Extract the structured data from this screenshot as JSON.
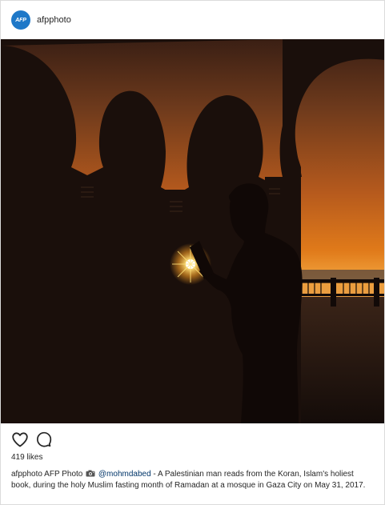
{
  "header": {
    "avatar_text": "AFP",
    "username": "afpphoto"
  },
  "photo": {
    "description_icon": "sunset-mosque-photo"
  },
  "actions": {
    "like_icon": "heart-icon",
    "comment_icon": "comment-icon"
  },
  "likes": {
    "text": "419 likes"
  },
  "caption": {
    "username": "afpphoto",
    "text_before_camera": " AFP Photo ",
    "camera_icon": "camera-icon",
    "mention": " @mohmdabed",
    "text_after": " - A Palestinian man reads from the Koran, Islam's holiest book, during the holy Muslim fasting month of Ramadan at a mosque in Gaza City on May 31, 2017."
  },
  "colors": {
    "avatar": "#1e78c8",
    "text": "#262626",
    "mention": "#003569",
    "border": "#dbdbdb",
    "sky_top": "#6e3a1c",
    "sky_mid": "#e07a1a",
    "sun": "#ffe27a"
  }
}
